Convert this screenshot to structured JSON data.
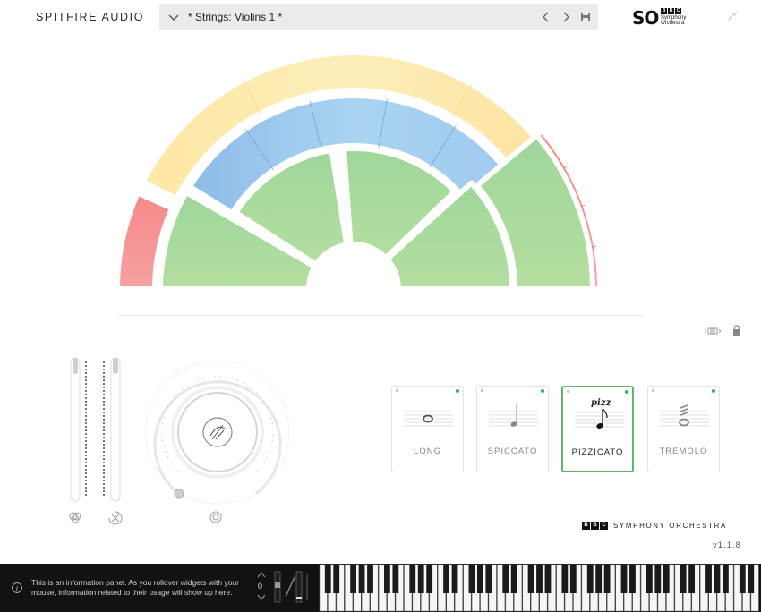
{
  "header": {
    "brand": "SPITFIRE AUDIO",
    "preset_name": "* Strings: Violins 1 *",
    "logo": {
      "so": "SO",
      "bbc": [
        "B",
        "B",
        "C"
      ],
      "line1": "Symphony",
      "line2": "Orchestra"
    }
  },
  "orchestra": {
    "sections": [
      {
        "name": "percussion-left",
        "color": "#f48f8f"
      },
      {
        "name": "brass",
        "color": "#fbe6a8"
      },
      {
        "name": "woodwinds",
        "color": "#9cc7ec"
      },
      {
        "name": "strings",
        "color": "#a9dba2"
      },
      {
        "name": "percussion-right",
        "color": "#f48f8f"
      }
    ]
  },
  "articulations": [
    {
      "label": "LONG",
      "active": false
    },
    {
      "label": "SPICCATO",
      "active": false
    },
    {
      "label": "PIZZICATO",
      "active": true,
      "marking": "pizz"
    },
    {
      "label": "TREMOLO",
      "active": false
    }
  ],
  "footer_logo": {
    "bbc": [
      "B",
      "B",
      "C"
    ],
    "text": "SYMPHONY ORCHESTRA"
  },
  "version": "v1.1.8",
  "info_panel": {
    "text": "This is an information panel. As you rollover widgets with your mouse, information related to their usage will show up here."
  },
  "octave": {
    "value": "0"
  },
  "colors": {
    "accent_green": "#5db86a",
    "active_dot": "#3bb34a",
    "bottom_bar": "#121212"
  },
  "icons": [
    "chevron-down-icon",
    "chevron-left-icon",
    "chevron-right-icon",
    "save-icon",
    "collapse-icon",
    "keyboard-range-icon",
    "lock-icon",
    "info-icon",
    "dynamics-icon",
    "expression-icon",
    "reverb-icon"
  ]
}
